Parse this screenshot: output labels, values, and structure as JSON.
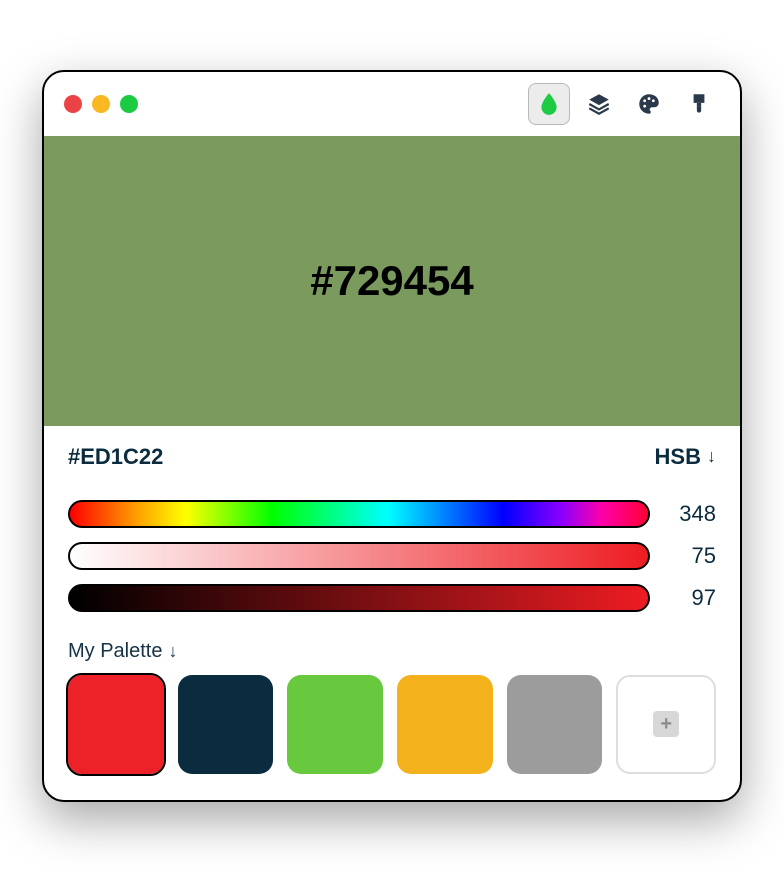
{
  "hero": {
    "hex_label": "#729454",
    "bg": "#7A9A5E"
  },
  "current_hex": "#ED1C22",
  "mode_label": "HSB",
  "sliders": {
    "hue": 348,
    "sat": 75,
    "brt": 97
  },
  "palette_label": "My Palette",
  "palette": [
    {
      "color": "#ED2228",
      "selected": true
    },
    {
      "color": "#0B2B3E",
      "selected": false
    },
    {
      "color": "#68C93E",
      "selected": false
    },
    {
      "color": "#F3B21B",
      "selected": false
    },
    {
      "color": "#9C9C9C",
      "selected": false
    }
  ],
  "icons": {
    "drop": "drop-icon",
    "layers": "layers-icon",
    "palette": "palette-icon",
    "brush": "brush-icon"
  }
}
